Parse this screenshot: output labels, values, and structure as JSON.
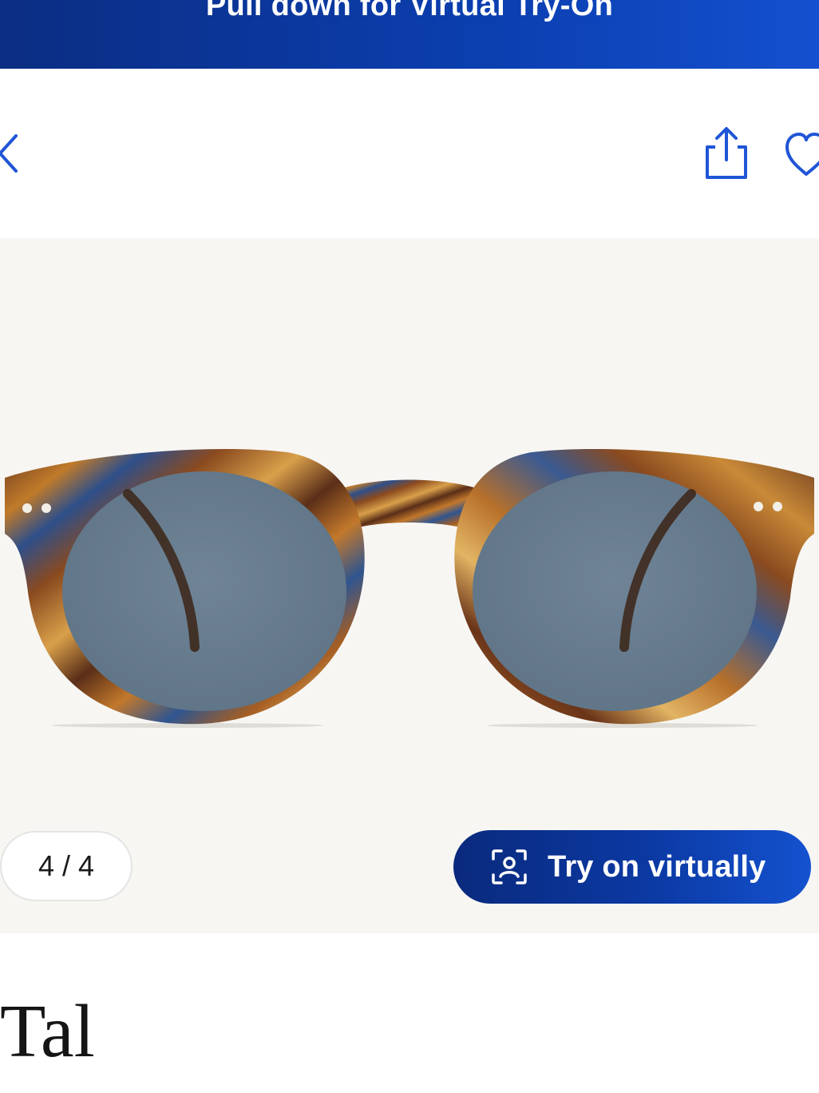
{
  "banner": {
    "text": "Pull down for Virtual Try-On"
  },
  "header": {
    "back_icon": "chevron-left-icon",
    "share_icon": "share-icon",
    "favorite_icon": "heart-icon"
  },
  "gallery": {
    "counter": "4 / 4",
    "current_index": 4,
    "total": 4,
    "try_on_button": {
      "label": "Try on virtually",
      "icon": "face-scan-icon"
    }
  },
  "product": {
    "name": "Tal"
  },
  "colors": {
    "brand_blue": "#0b39a3",
    "icon_blue": "#1f55d6",
    "gallery_background": "#f7f6f3"
  }
}
